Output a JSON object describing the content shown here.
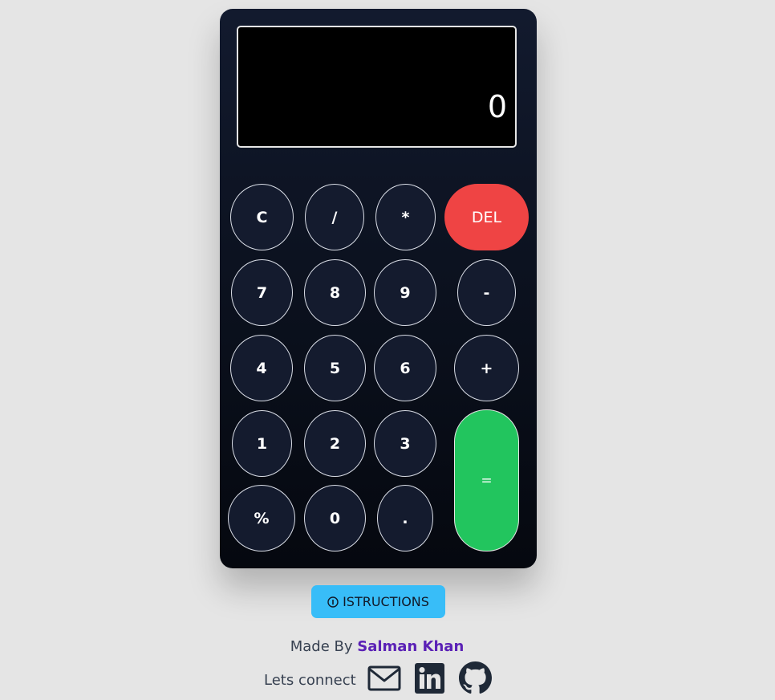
{
  "display": {
    "value": "0"
  },
  "keys": {
    "clear": "C",
    "divide": "/",
    "multiply": "*",
    "delete": "DEL",
    "seven": "7",
    "eight": "8",
    "nine": "9",
    "minus": "-",
    "four": "4",
    "five": "5",
    "six": "6",
    "plus": "+",
    "one": "1",
    "two": "2",
    "three": "3",
    "equals": "=",
    "percent": "%",
    "zero": "0",
    "decimal": "."
  },
  "instructions": {
    "label": "ISTRUCTIONS",
    "icon": "info-icon"
  },
  "footer": {
    "made_by_label": "Made By",
    "author": "Salman Khan",
    "connect_label": "Lets connect",
    "social_icons": [
      "mail-icon",
      "linkedin-icon",
      "github-icon"
    ]
  },
  "colors": {
    "page_background": "#e5e5e5",
    "calculator_body": "#0c1220",
    "delete_key": "#ef4444",
    "equals_key": "#22c55e",
    "instructions_button": "#38bdf8",
    "author_link": "#5b21b6"
  }
}
